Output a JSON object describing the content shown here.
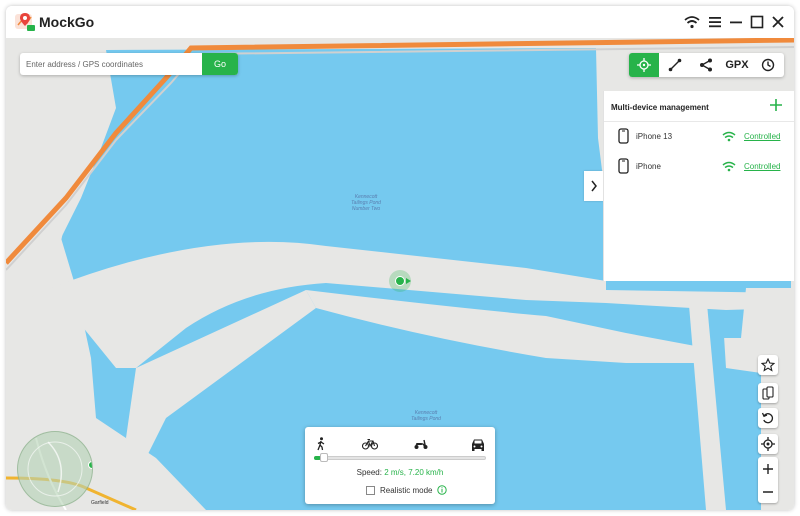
{
  "app": {
    "title": "MockGo"
  },
  "search": {
    "placeholder": "Enter address / GPS coordinates",
    "go_label": "Go"
  },
  "toolbar": {
    "gpx_label": "GPX",
    "tools": [
      "teleport-icon",
      "two-spot-route-icon",
      "multi-spot-route-icon",
      "gpx-label",
      "history-icon"
    ]
  },
  "device_panel": {
    "title": "Multi-device management",
    "devices": [
      {
        "name": "iPhone 13",
        "status": "Controlled"
      },
      {
        "name": "iPhone",
        "status": "Controlled"
      }
    ]
  },
  "map_labels": {
    "pond_north": "Kennecott\nTailings Pond\nNumber Two",
    "pond_south": "Kennecott\nTailings Pond",
    "street_garfield": "Garfield"
  },
  "speed_panel": {
    "modes": [
      "walk-icon",
      "bike-icon",
      "scooter-icon",
      "car-icon"
    ],
    "speed_label": "Speed:",
    "speed_value": "2 m/s, 7.20 km/h",
    "slider_fraction": 0.04,
    "realistic_label": "Realistic mode"
  },
  "colors": {
    "accent": "#27b34a",
    "water": "#75c9ef",
    "land": "#e7e7e5",
    "highway": "#f08a3c"
  }
}
